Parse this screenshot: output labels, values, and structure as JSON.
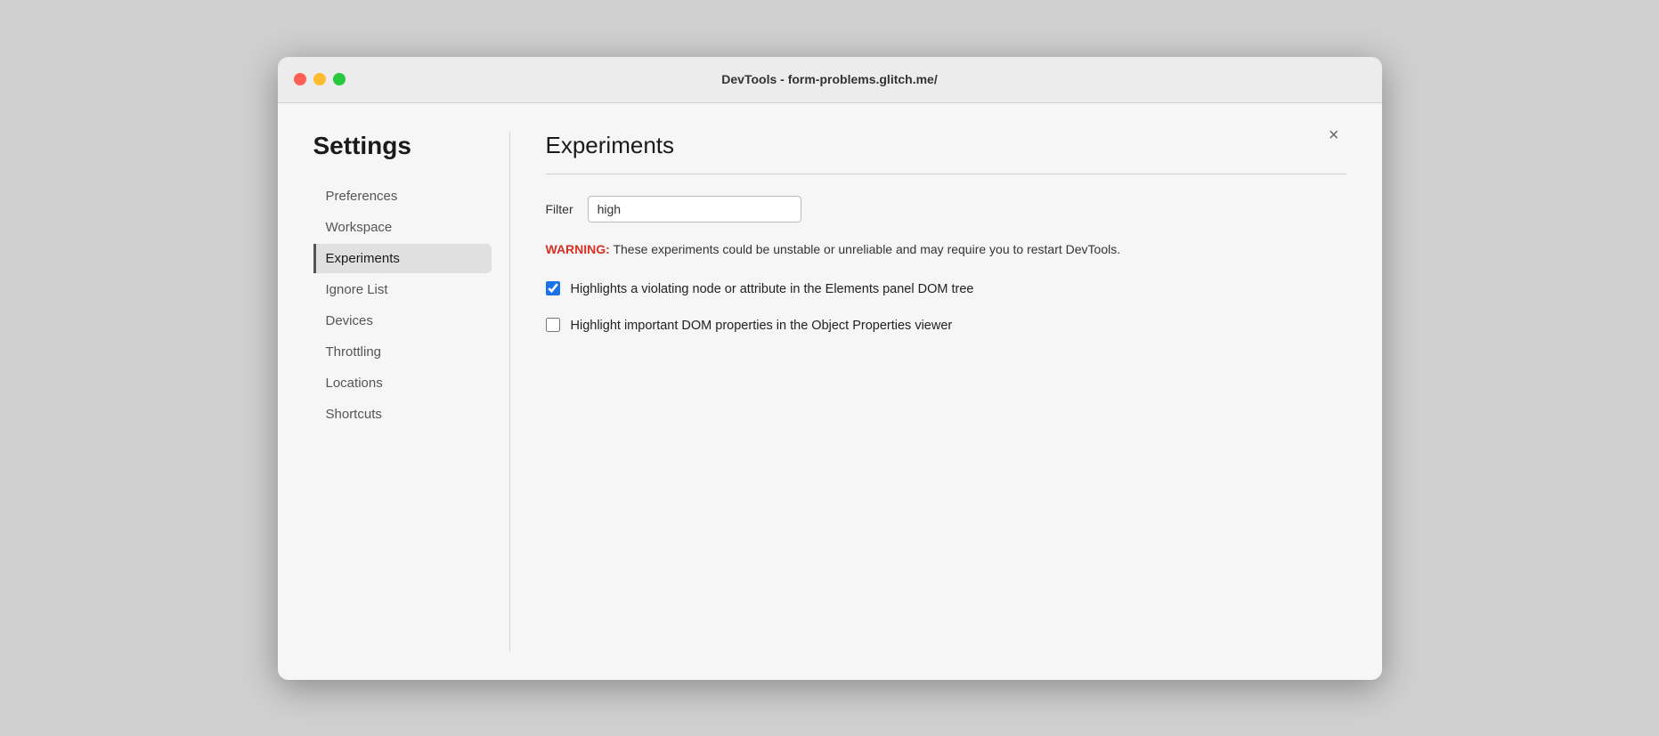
{
  "window": {
    "title": "DevTools - form-problems.glitch.me/"
  },
  "sidebar": {
    "heading": "Settings",
    "items": [
      {
        "id": "preferences",
        "label": "Preferences",
        "active": false
      },
      {
        "id": "workspace",
        "label": "Workspace",
        "active": false
      },
      {
        "id": "experiments",
        "label": "Experiments",
        "active": true
      },
      {
        "id": "ignore-list",
        "label": "Ignore List",
        "active": false
      },
      {
        "id": "devices",
        "label": "Devices",
        "active": false
      },
      {
        "id": "throttling",
        "label": "Throttling",
        "active": false
      },
      {
        "id": "locations",
        "label": "Locations",
        "active": false
      },
      {
        "id": "shortcuts",
        "label": "Shortcuts",
        "active": false
      }
    ]
  },
  "main": {
    "section_title": "Experiments",
    "close_label": "×",
    "filter": {
      "label": "Filter",
      "value": "high",
      "placeholder": ""
    },
    "warning": {
      "prefix": "WARNING:",
      "text": " These experiments could be unstable or unreliable and may require you to restart DevTools."
    },
    "experiments": [
      {
        "id": "exp1",
        "label": "Highlights a violating node or attribute in the Elements panel DOM tree",
        "checked": true
      },
      {
        "id": "exp2",
        "label": "Highlight important DOM properties in the Object Properties viewer",
        "checked": false
      }
    ]
  },
  "traffic_lights": {
    "close_title": "Close",
    "minimize_title": "Minimize",
    "maximize_title": "Maximize"
  }
}
